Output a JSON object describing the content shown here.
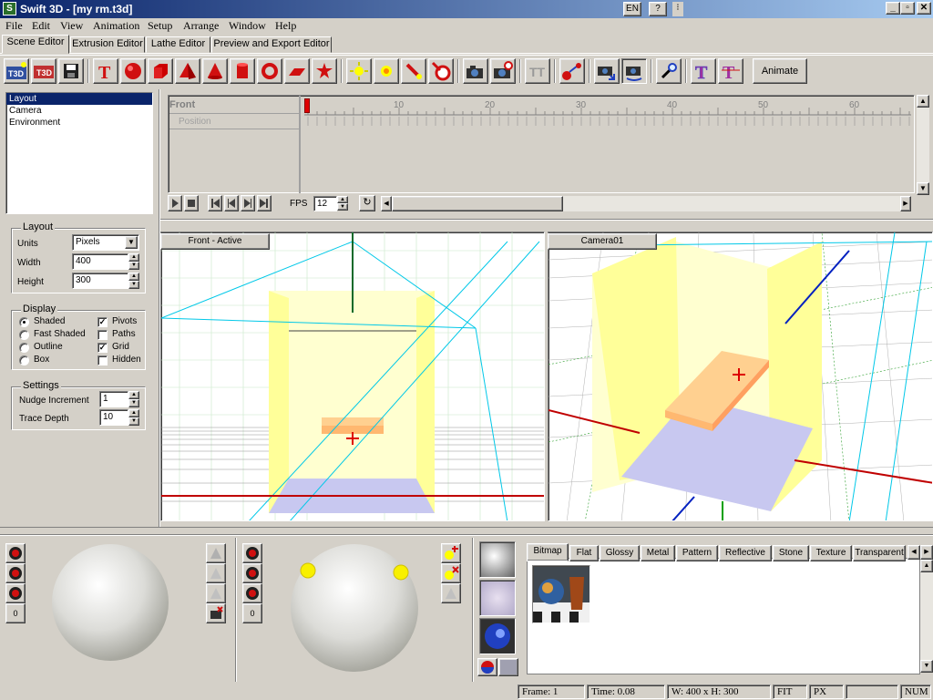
{
  "window": {
    "title": "Swift 3D - [my rm.t3d]",
    "app_icon": "S",
    "ime_lang": "EN",
    "ime_help": "?",
    "ime_menu": "⁝",
    "minimize": "_",
    "maximize": "▫",
    "close": "✕"
  },
  "menu": [
    "File",
    "Edit",
    "View",
    "Animation",
    "Setup",
    "Arrange",
    "Window",
    "Help"
  ],
  "editor_tabs": [
    "Scene Editor",
    "Extrusion Editor",
    "Lathe Editor",
    "Preview and Export Editor"
  ],
  "toolbar": {
    "t3d_label": "T3D",
    "tt_label": "TT",
    "animate_label": "Animate",
    "icons": [
      "new-t3d-icon",
      "open-t3d-icon",
      "save-icon",
      "text-icon",
      "sphere-icon",
      "cube-icon",
      "pyramid-icon",
      "cone-icon",
      "cylinder-icon",
      "torus-icon",
      "plane-icon",
      "star-icon",
      "light-icon",
      "spot-light-icon",
      "point-light-icon",
      "target-light-icon",
      "camera-icon",
      "target-camera-icon",
      "text-tool-icon",
      "connect-icon",
      "camera-move-icon",
      "camera-rotate-icon",
      "zoom-icon",
      "text-bevel-icon",
      "text-bevel2-icon"
    ]
  },
  "hierarchy": {
    "items": [
      "Layout",
      "Camera",
      "Environment"
    ],
    "selected": "Layout"
  },
  "layout_group": {
    "title": "Layout",
    "units_label": "Units",
    "units_value": "Pixels",
    "width_label": "Width",
    "width_value": "400",
    "height_label": "Height",
    "height_value": "300"
  },
  "display_group": {
    "title": "Display",
    "radios": [
      {
        "label": "Shaded",
        "checked": true
      },
      {
        "label": "Fast Shaded",
        "checked": false
      },
      {
        "label": "Outline",
        "checked": false
      },
      {
        "label": "Box",
        "checked": false
      }
    ],
    "checks": [
      {
        "label": "Pivots",
        "checked": true
      },
      {
        "label": "Paths",
        "checked": false
      },
      {
        "label": "Grid",
        "checked": true
      },
      {
        "label": "Hidden",
        "checked": false
      }
    ],
    "check_mark": "✓"
  },
  "settings_group": {
    "title": "Settings",
    "nudge_label": "Nudge Increment",
    "nudge_value": "1",
    "trace_label": "Trace Depth",
    "trace_value": "10"
  },
  "timeline": {
    "track_name": "Front",
    "sub_track": "Position",
    "ticks": [
      "10",
      "20",
      "30",
      "40",
      "50",
      "60"
    ],
    "fps_label": "FPS",
    "fps_value": "12"
  },
  "viewports": {
    "left_label": "Front - Active",
    "right_label": "Camera01"
  },
  "lighting": {
    "left_counter": "0",
    "right_counter": "0"
  },
  "materials": {
    "tabs": [
      "Bitmap",
      "Flat",
      "Glossy",
      "Metal",
      "Pattern",
      "Reflective",
      "Stone",
      "Texture",
      "Transparent"
    ],
    "active_tab": "Bitmap"
  },
  "status": {
    "frame": "Frame: 1",
    "time": "Time: 0.08",
    "size": "W: 400 x H: 300",
    "fit": "FIT",
    "units": "PX",
    "num": "NUM"
  },
  "colors": {
    "title_gradient_start": "#0a246a",
    "title_gradient_end": "#a6caf0",
    "chrome": "#d4d0c8",
    "selection": "#0a246a",
    "grid_cyan": "#00c8e8",
    "wall_yellow": "#ffff99",
    "floor_lavender": "#c8c8f0",
    "table_orange": "#ffc880"
  }
}
